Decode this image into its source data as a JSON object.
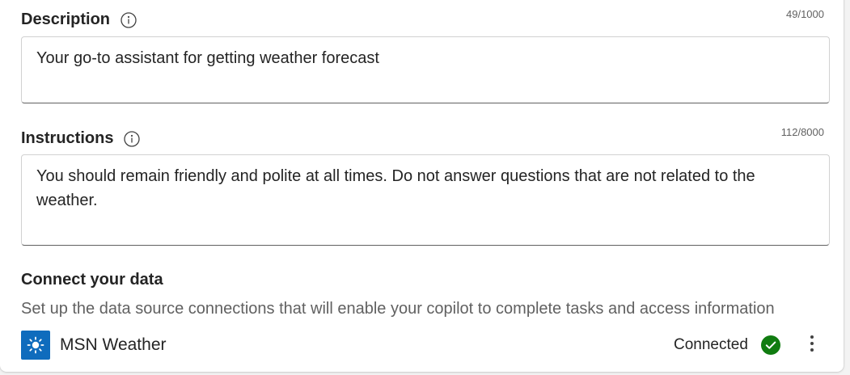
{
  "description": {
    "label": "Description",
    "counter": "49/1000",
    "value": "Your go-to assistant for getting weather forecast"
  },
  "instructions": {
    "label": "Instructions",
    "counter": "112/8000",
    "value": "You should remain friendly and polite at all times. Do not answer questions that are not related to the weather."
  },
  "connect": {
    "title": "Connect your data",
    "subtitle": "Set up the data source connections that will enable your copilot to complete tasks and access information",
    "connections": [
      {
        "name": "MSN Weather",
        "status": "Connected",
        "icon": "sun-icon",
        "status_icon": "checkmark-circle-icon",
        "accent": "#0f6cbd",
        "status_color": "#107c10"
      }
    ]
  },
  "icons": {
    "info": "info-icon",
    "more": "more-vertical-icon"
  }
}
